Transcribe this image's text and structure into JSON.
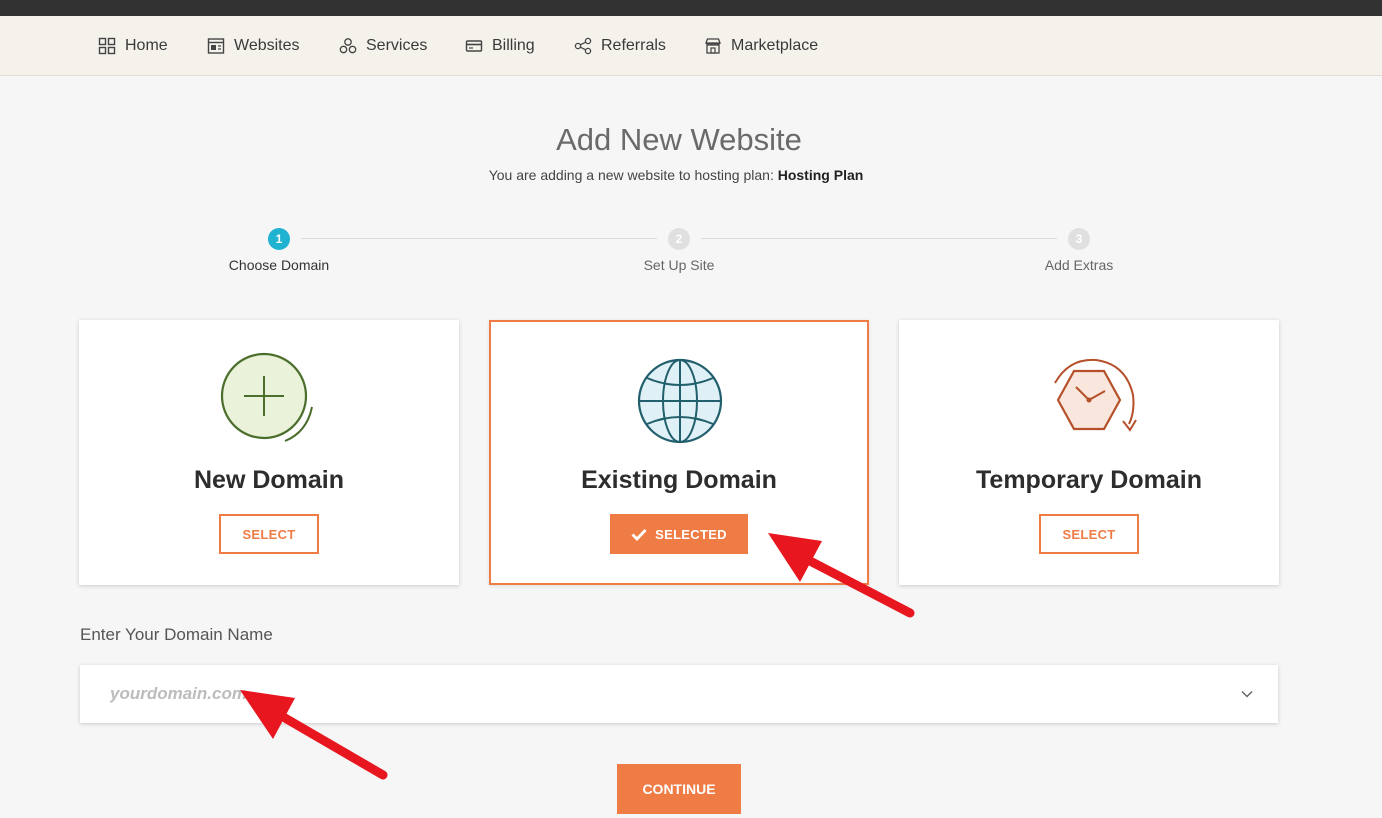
{
  "nav": {
    "items": [
      {
        "label": "Home",
        "icon": "grid-icon"
      },
      {
        "label": "Websites",
        "icon": "website-icon"
      },
      {
        "label": "Services",
        "icon": "services-icon"
      },
      {
        "label": "Billing",
        "icon": "credit-card-icon"
      },
      {
        "label": "Referrals",
        "icon": "share-icon"
      },
      {
        "label": "Marketplace",
        "icon": "store-icon"
      }
    ]
  },
  "page": {
    "title": "Add New Website",
    "subtitle_prefix": "You are adding a new website to hosting plan:",
    "plan_name": "Hosting Plan"
  },
  "steps": [
    {
      "number": "1",
      "label": "Choose Domain",
      "active": true
    },
    {
      "number": "2",
      "label": "Set Up Site",
      "active": false
    },
    {
      "number": "3",
      "label": "Add Extras",
      "active": false
    }
  ],
  "options": [
    {
      "title": "New Domain",
      "button": "SELECT",
      "selected": false,
      "icon": "plus-circle-icon"
    },
    {
      "title": "Existing Domain",
      "button": "SELECTED",
      "selected": true,
      "icon": "globe-icon"
    },
    {
      "title": "Temporary Domain",
      "button": "SELECT",
      "selected": false,
      "icon": "clock-icon"
    }
  ],
  "domain_field": {
    "label": "Enter Your Domain Name",
    "value": "",
    "placeholder": "yourdomain.com"
  },
  "continue_label": "CONTINUE",
  "colors": {
    "accent": "#ef7c45",
    "step_active": "#1fb3d1",
    "annotation_arrow": "#e8171f",
    "topbar": "#333232",
    "navbar": "#f5f2ec"
  }
}
